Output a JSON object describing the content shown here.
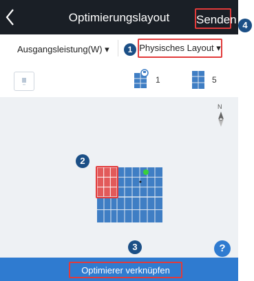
{
  "header": {
    "title": "Optimierungslayout",
    "send_label": "Senden",
    "callout_4": "4"
  },
  "toolbar": {
    "output_dropdown_label": "Ausgangsleistung(W) ▾",
    "layout_dropdown_label": "Physisches Layout ▾",
    "callout_1": "1"
  },
  "stats": {
    "optimizer_count": "1",
    "module_count": "5"
  },
  "canvas": {
    "compass_label": "N",
    "callout_2": "2",
    "callout_3": "3"
  },
  "footer": {
    "link_optimizer_label": "Optimierer verknüpfen",
    "help_label": "?"
  },
  "colors": {
    "header_bg": "#1a1f26",
    "accent_blue": "#2f7bd0",
    "panel_blue": "#3f7ec4",
    "highlight_red": "#e23a3a",
    "selected_panel_red": "#e25a5a",
    "online_dot_green": "#3ad13a"
  }
}
